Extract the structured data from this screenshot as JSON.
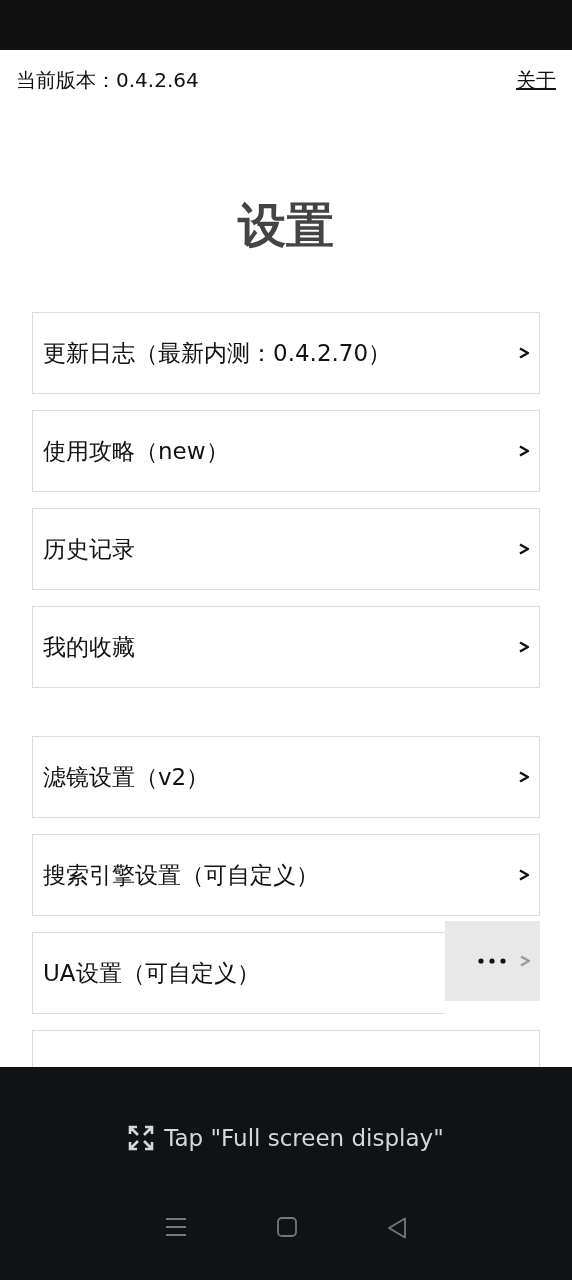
{
  "header": {
    "version_label": "当前版本：0.4.2.64",
    "about_link": "关于"
  },
  "title": "设置",
  "groups": [
    {
      "items": [
        {
          "kind": "arrow",
          "label": "更新日志（最新内测：0.4.2.70）"
        },
        {
          "kind": "arrow",
          "label": "使用攻略（new）"
        },
        {
          "kind": "arrow",
          "label": "历史记录"
        },
        {
          "kind": "arrow",
          "label": "我的收藏"
        }
      ]
    },
    {
      "items": [
        {
          "kind": "arrow",
          "label": "滤镜设置（v2）"
        },
        {
          "kind": "arrow",
          "label": "搜索引擎设置（可自定义）"
        },
        {
          "kind": "more",
          "label": "UA设置（可自定义）"
        },
        {
          "kind": "covered"
        }
      ]
    }
  ],
  "overlay": {
    "hint": "Tap \"Full screen display\""
  }
}
